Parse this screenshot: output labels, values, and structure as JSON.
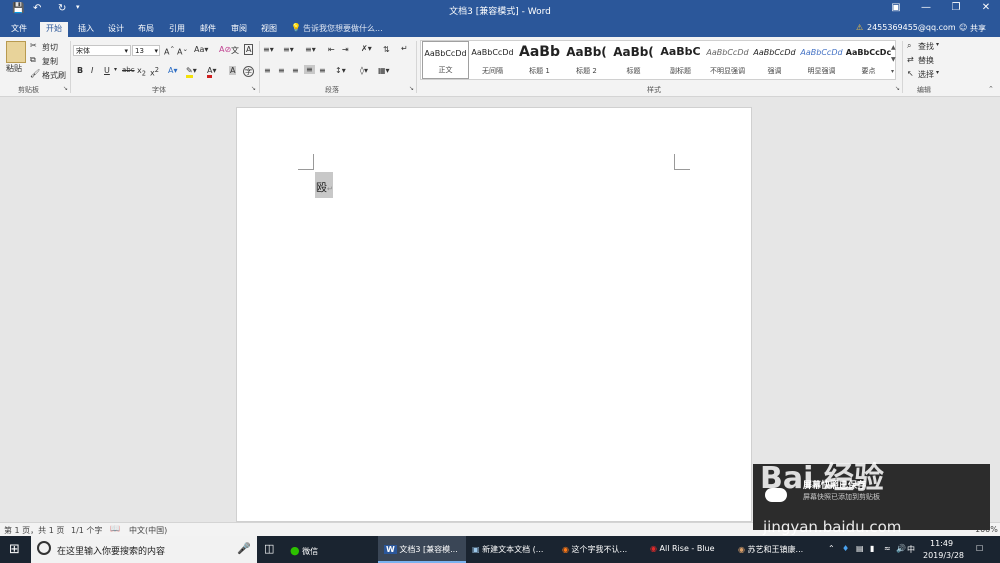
{
  "window": {
    "title": "文档3 [兼容模式] - Word"
  },
  "tabs": [
    "文件",
    "开始",
    "插入",
    "设计",
    "布局",
    "引用",
    "邮件",
    "审阅",
    "视图"
  ],
  "tell_me": "告诉我您想要做什么...",
  "account": {
    "email": "2455369455@qq.com",
    "share": "共享"
  },
  "clipboard": {
    "paste": "粘贴",
    "cut": "剪切",
    "copy": "复制",
    "format_painter": "格式刷",
    "group": "剪贴板"
  },
  "font": {
    "name": "宋体",
    "size": "13",
    "group": "字体"
  },
  "paragraph": {
    "group": "段落"
  },
  "styles": {
    "group": "样式",
    "items": [
      {
        "sample": "AaBbCcDd",
        "name": "正文"
      },
      {
        "sample": "AaBbCcDd",
        "name": "无间隔"
      },
      {
        "sample": "AaBb",
        "name": "标题 1"
      },
      {
        "sample": "AaBb(",
        "name": "标题 2"
      },
      {
        "sample": "AaBb(",
        "name": "标题"
      },
      {
        "sample": "AaBbC",
        "name": "副标题"
      },
      {
        "sample": "AaBbCcDd",
        "name": "不明显强调"
      },
      {
        "sample": "AaBbCcDd",
        "name": "强调"
      },
      {
        "sample": "AaBbCcDd",
        "name": "明显强调"
      },
      {
        "sample": "AaBbCcDc",
        "name": "要点"
      }
    ]
  },
  "editing": {
    "find": "查找",
    "replace": "替换",
    "select": "选择",
    "group": "编辑"
  },
  "document": {
    "text": "殴"
  },
  "status": {
    "page": "第 1 页，共 1 页",
    "words": "1/1 个字",
    "lang": "中文(中国)",
    "zoom": "100%"
  },
  "toast": {
    "title": "屏幕快照已保存",
    "body": "屏幕快照已添加到剪贴板"
  },
  "watermark": {
    "text": "Bai 经验",
    "url": "jingyan.baidu.com"
  },
  "taskbar": {
    "search_placeholder": "在这里输入你要搜索的内容",
    "apps": [
      {
        "label": "微信"
      },
      {
        "label": "文档3 [兼容模..."
      },
      {
        "label": "新建文本文档 (..."
      },
      {
        "label": "这个字我不认..."
      },
      {
        "label": "All Rise - Blue"
      },
      {
        "label": "苏艺和王镇康..."
      }
    ],
    "ime": "中",
    "time": "11:49",
    "date": "2019/3/28"
  }
}
